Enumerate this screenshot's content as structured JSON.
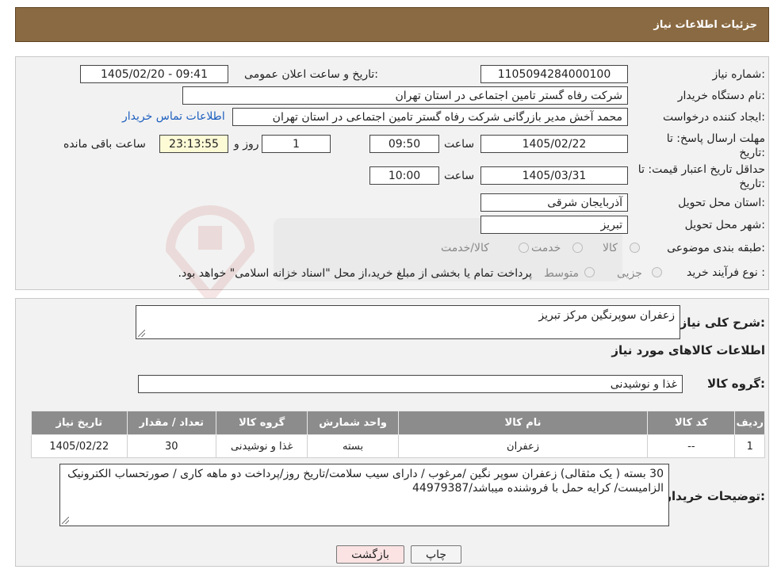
{
  "header": {
    "title": "جزئیات اطلاعات نیاز"
  },
  "form": {
    "need_number_label": "شماره نیاز:",
    "need_number": "1105094284000100",
    "announce_label": "تاریخ و ساعت اعلان عمومی:",
    "announce_value": "1405/02/20 - 09:41",
    "buyer_org_label": "نام دستگاه خریدار:",
    "buyer_org": "شرکت رفاه گستر تامین اجتماعی در استان تهران",
    "creator_label": "ایجاد کننده درخواست:",
    "creator": "محمد آخش مدیر بازرگانی شرکت رفاه گستر تامین اجتماعی در استان تهران",
    "contact_link": "اطلاعات تماس خریدار",
    "deadline_label": "مهلت ارسال پاسخ: تا تاریخ:",
    "deadline_date": "1405/02/22",
    "time_label": "ساعت",
    "deadline_time": "09:50",
    "days_value": "1",
    "days_label": "روز و",
    "remaining_time": "23:13:55",
    "remaining_label": "ساعت باقی مانده",
    "validity_label": "حداقل تاریخ اعتبار قیمت: تا تاریخ:",
    "validity_date": "1405/03/31",
    "validity_time": "10:00",
    "province_label": "استان محل تحویل:",
    "province": "آذربایجان شرقی",
    "city_label": "شهر محل تحویل:",
    "city": "تبریز",
    "category_label": "طبقه بندی موضوعی:",
    "category_options": [
      "کالا",
      "خدمت",
      "کالا/خدمت"
    ],
    "process_label": "نوع فرآیند خرید :",
    "process_options": [
      "جزیی",
      "متوسط"
    ],
    "process_note": "پرداخت تمام یا بخشی از مبلغ خرید،از محل \"اسناد خزانه اسلامی\" خواهد بود."
  },
  "summary": {
    "general_desc_label": "شرح کلی نیاز:",
    "general_desc": "زعفران سوپرنگین مرکز تبریز",
    "goods_info_title": "اطلاعات کالاهای مورد نیاز",
    "goods_group_label": "گروه کالا:",
    "goods_group": "غذا و نوشیدنی"
  },
  "table": {
    "headers": [
      "ردیف",
      "کد کالا",
      "نام کالا",
      "واحد شمارش",
      "گروه کالا",
      "تعداد / مقدار",
      "تاریخ نیاز"
    ],
    "rows": [
      [
        "1",
        "--",
        "زعفران",
        "بسته",
        "غذا و نوشیدنی",
        "30",
        "1405/02/22"
      ]
    ]
  },
  "buyer_notes": {
    "label": "توضیحات خریدار:",
    "text": "30 بسته ( یک مثقالی) زعفران سوپر نگین /مرغوب / دارای سیب سلامت/تاریخ روز/پرداخت دو ماهه کاری / صورتحساب الکترونیک الزامیست/ کرایه حمل با فروشنده میباشد/44979387"
  },
  "buttons": {
    "print": "چاپ",
    "back": "بازگشت"
  },
  "colors": {
    "header": "#8a6a42",
    "table_header": "#8c8c8c",
    "link": "#1e5fbf",
    "back_button": "#fbe3e3",
    "print_button": "#f4f4f4"
  }
}
